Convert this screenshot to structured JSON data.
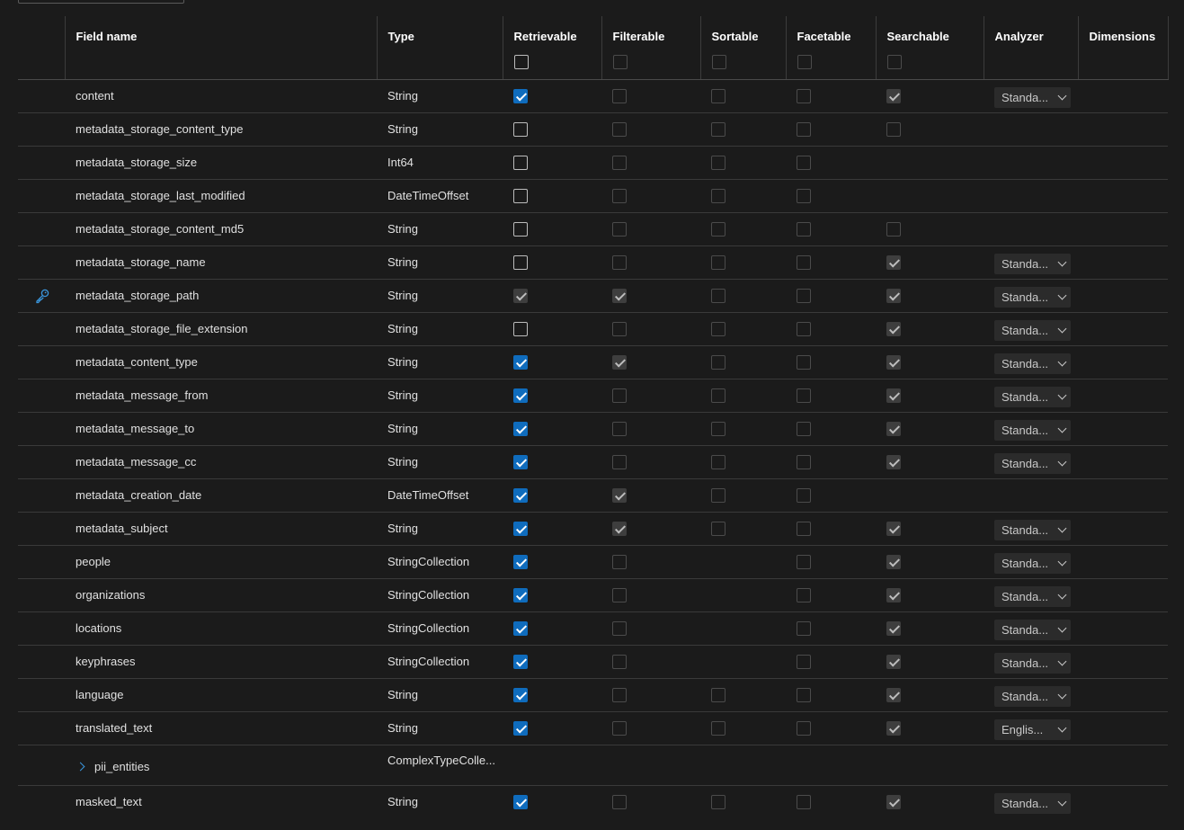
{
  "headers": {
    "field_name": "Field name",
    "type": "Type",
    "retrievable": "Retrievable",
    "filterable": "Filterable",
    "sortable": "Sortable",
    "facetable": "Facetable",
    "searchable": "Searchable",
    "analyzer": "Analyzer",
    "dimensions": "Dimensions"
  },
  "header_checkboxes": {
    "retrievable": "unchecked",
    "filterable": "disabled",
    "sortable": "disabled",
    "facetable": "disabled",
    "searchable": "disabled"
  },
  "icons": {
    "key": "key-icon",
    "expand": "chevron-right-icon",
    "dropdown": "chevron-down-icon"
  },
  "colors": {
    "accent": "#0f6cbd",
    "key_icon": "#3a96dd",
    "background": "#1b1b1b"
  },
  "rows": [
    {
      "name": "content",
      "type": "String",
      "key": false,
      "retrievable": "checked",
      "filterable": "disabled",
      "sortable": "disabled",
      "facetable": "disabled",
      "searchable": "checked-disabled",
      "analyzer": "Standa..."
    },
    {
      "name": "metadata_storage_content_type",
      "type": "String",
      "key": false,
      "retrievable": "unchecked",
      "filterable": "disabled",
      "sortable": "disabled",
      "facetable": "disabled",
      "searchable": "disabled",
      "analyzer": ""
    },
    {
      "name": "metadata_storage_size",
      "type": "Int64",
      "key": false,
      "retrievable": "unchecked",
      "filterable": "disabled",
      "sortable": "disabled",
      "facetable": "disabled",
      "searchable": "none",
      "analyzer": ""
    },
    {
      "name": "metadata_storage_last_modified",
      "type": "DateTimeOffset",
      "key": false,
      "retrievable": "unchecked",
      "filterable": "disabled",
      "sortable": "disabled",
      "facetable": "disabled",
      "searchable": "none",
      "analyzer": ""
    },
    {
      "name": "metadata_storage_content_md5",
      "type": "String",
      "key": false,
      "retrievable": "unchecked",
      "filterable": "disabled",
      "sortable": "disabled",
      "facetable": "disabled",
      "searchable": "disabled",
      "analyzer": ""
    },
    {
      "name": "metadata_storage_name",
      "type": "String",
      "key": false,
      "retrievable": "unchecked",
      "filterable": "disabled",
      "sortable": "disabled",
      "facetable": "disabled",
      "searchable": "checked-disabled",
      "analyzer": "Standa..."
    },
    {
      "name": "metadata_storage_path",
      "type": "String",
      "key": true,
      "retrievable": "checked-disabled",
      "filterable": "checked-disabled",
      "sortable": "disabled",
      "facetable": "disabled",
      "searchable": "checked-disabled",
      "analyzer": "Standa..."
    },
    {
      "name": "metadata_storage_file_extension",
      "type": "String",
      "key": false,
      "retrievable": "unchecked",
      "filterable": "disabled",
      "sortable": "disabled",
      "facetable": "disabled",
      "searchable": "checked-disabled",
      "analyzer": "Standa..."
    },
    {
      "name": "metadata_content_type",
      "type": "String",
      "key": false,
      "retrievable": "checked",
      "filterable": "checked-disabled",
      "sortable": "disabled",
      "facetable": "disabled",
      "searchable": "checked-disabled",
      "analyzer": "Standa..."
    },
    {
      "name": "metadata_message_from",
      "type": "String",
      "key": false,
      "retrievable": "checked",
      "filterable": "disabled",
      "sortable": "disabled",
      "facetable": "disabled",
      "searchable": "checked-disabled",
      "analyzer": "Standa..."
    },
    {
      "name": "metadata_message_to",
      "type": "String",
      "key": false,
      "retrievable": "checked",
      "filterable": "disabled",
      "sortable": "disabled",
      "facetable": "disabled",
      "searchable": "checked-disabled",
      "analyzer": "Standa..."
    },
    {
      "name": "metadata_message_cc",
      "type": "String",
      "key": false,
      "retrievable": "checked",
      "filterable": "disabled",
      "sortable": "disabled",
      "facetable": "disabled",
      "searchable": "checked-disabled",
      "analyzer": "Standa..."
    },
    {
      "name": "metadata_creation_date",
      "type": "DateTimeOffset",
      "key": false,
      "retrievable": "checked",
      "filterable": "checked-disabled",
      "sortable": "disabled",
      "facetable": "disabled",
      "searchable": "none",
      "analyzer": ""
    },
    {
      "name": "metadata_subject",
      "type": "String",
      "key": false,
      "retrievable": "checked",
      "filterable": "checked-disabled",
      "sortable": "disabled",
      "facetable": "disabled",
      "searchable": "checked-disabled",
      "analyzer": "Standa..."
    },
    {
      "name": "people",
      "type": "StringCollection",
      "key": false,
      "retrievable": "checked",
      "filterable": "disabled",
      "sortable": "none",
      "facetable": "disabled",
      "searchable": "checked-disabled",
      "analyzer": "Standa..."
    },
    {
      "name": "organizations",
      "type": "StringCollection",
      "key": false,
      "retrievable": "checked",
      "filterable": "disabled",
      "sortable": "none",
      "facetable": "disabled",
      "searchable": "checked-disabled",
      "analyzer": "Standa..."
    },
    {
      "name": "locations",
      "type": "StringCollection",
      "key": false,
      "retrievable": "checked",
      "filterable": "disabled",
      "sortable": "none",
      "facetable": "disabled",
      "searchable": "checked-disabled",
      "analyzer": "Standa..."
    },
    {
      "name": "keyphrases",
      "type": "StringCollection",
      "key": false,
      "retrievable": "checked",
      "filterable": "disabled",
      "sortable": "none",
      "facetable": "disabled",
      "searchable": "checked-disabled",
      "analyzer": "Standa..."
    },
    {
      "name": "language",
      "type": "String",
      "key": false,
      "retrievable": "checked",
      "filterable": "disabled",
      "sortable": "disabled",
      "facetable": "disabled",
      "searchable": "checked-disabled",
      "analyzer": "Standa..."
    },
    {
      "name": "translated_text",
      "type": "String",
      "key": false,
      "retrievable": "checked",
      "filterable": "disabled",
      "sortable": "disabled",
      "facetable": "disabled",
      "searchable": "checked-disabled",
      "analyzer": "Englis..."
    },
    {
      "name": "pii_entities",
      "type": "ComplexTypeColle...",
      "key": false,
      "complex": true,
      "retrievable": "none",
      "filterable": "none",
      "sortable": "none",
      "facetable": "none",
      "searchable": "none",
      "analyzer": ""
    },
    {
      "name": "masked_text",
      "type": "String",
      "key": false,
      "retrievable": "checked",
      "filterable": "disabled",
      "sortable": "disabled",
      "facetable": "disabled",
      "searchable": "checked-disabled",
      "analyzer": "Standa..."
    }
  ]
}
